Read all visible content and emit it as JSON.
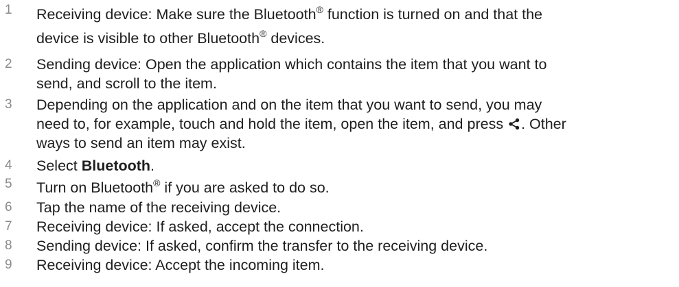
{
  "steps": [
    {
      "number": "1",
      "label": "Receiving device",
      "text_a": ": Make sure the Bluetooth",
      "reg": "®",
      "text_b": " function is turned on and that the",
      "text_c": "device is visible to other Bluetooth",
      "reg2": "®",
      "text_d": " devices."
    },
    {
      "number": "2",
      "label": "Sending device",
      "text_a": ": Open the application which contains the item that you want to",
      "text_b": "send, and scroll to the item."
    },
    {
      "number": "3",
      "text_a": "Depending on the application and on the item that you want to send, you may",
      "text_b": "need to, for example, touch and hold the item, open the item, and press ",
      "text_c": ". Other",
      "text_d": "ways to send an item may exist."
    },
    {
      "number": "4",
      "text_a": "Select ",
      "bold": "Bluetooth",
      "text_b": "."
    },
    {
      "number": "5",
      "text_a": "Turn on Bluetooth",
      "reg": "®",
      "text_b": " if you are asked to do so."
    },
    {
      "number": "6",
      "text_a": "Tap the name of the receiving device."
    },
    {
      "number": "7",
      "label": "Receiving device",
      "text_a": ": If asked, accept the connection."
    },
    {
      "number": "8",
      "label": "Sending device",
      "text_a": ": If asked, confirm the transfer to the receiving device."
    },
    {
      "number": "9",
      "label": "Receiving device",
      "text_a": ": Accept the incoming item."
    }
  ],
  "icons": {
    "share": "share-icon"
  }
}
